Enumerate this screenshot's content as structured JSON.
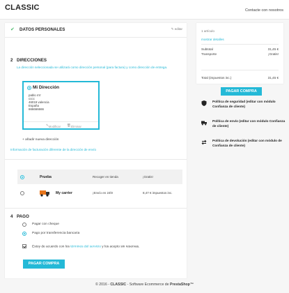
{
  "header": {
    "logo": "CLASSIC",
    "contact": "Contacte con nosotros"
  },
  "steps": {
    "personal": {
      "title": "Datos personales",
      "edit": "editar"
    },
    "addresses": {
      "number": "2",
      "title": "Direcciones",
      "help": "La dirección seleccionada se utilizará como dirección personal (para factura) y como dirección de entrega.",
      "card": {
        "alias": "Mi Dirección",
        "lines": [
          "pablo rrrr",
          "cccc",
          "46019 valencia",
          "España",
          "666666666"
        ],
        "modify": "Modificar",
        "delete": "Eliminar"
      },
      "add_new": "+ añadir nueva dirección",
      "billing_link": "Información de facturación diferente de la dirección de envío"
    },
    "shipping": {
      "carriers": [
        {
          "name": "Prueba",
          "delay": "Recoger en tienda",
          "price": "¡Gratis!",
          "selected": true
        },
        {
          "name": "My carrier",
          "delay": "¡Envío en 24h!",
          "price": "8,47 € impuestos inc.",
          "selected": false,
          "icon": "truck-icon"
        }
      ]
    },
    "payment": {
      "number": "4",
      "title": "Pago",
      "options": [
        "Pagar con cheque",
        "Pago por transferencia bancaria"
      ],
      "selected_option": 1,
      "terms_prefix": "Estoy de acuerdo con los ",
      "terms_link": "términos del servicio",
      "terms_suffix": " y los acepto sin reservas.",
      "terms_checked": true,
      "order_button": "Pagar compra"
    }
  },
  "summary": {
    "count": "1 artículo",
    "details": "mostrar detalles",
    "subtotal_label": "Subtotal",
    "subtotal_value": "31,45 €",
    "shipping_label": "Transporte",
    "shipping_value": "¡Gratis!",
    "total_label": "Total (impuestos inc.)",
    "total_value": "31,45 €",
    "order_button": "Pagar compra"
  },
  "reassurance": [
    {
      "icon": "shield-icon",
      "text": "Política de seguridad (editar con módulo Confianza de cliente)"
    },
    {
      "icon": "truck-icon",
      "text": "Política de envío (editar con módulo Confianza de cliente)"
    },
    {
      "icon": "exchange-arrows-icon",
      "text": "Política de devolución (editar con módulo de Confianza de cliente)"
    }
  ],
  "footer": {
    "prefix": "© 2016 - ",
    "brand": "CLASSIC",
    "middle": " - Software Ecommerce de ",
    "software": "PrestaShop™"
  },
  "colors": {
    "accent": "#24b9d7",
    "success": "#4cbb6c"
  }
}
